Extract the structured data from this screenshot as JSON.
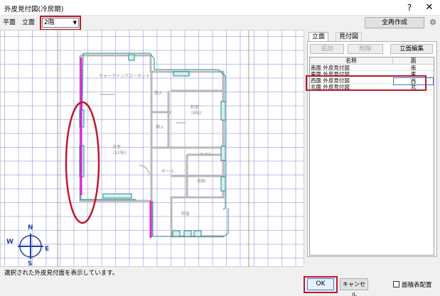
{
  "window": {
    "title": "外皮見付図(冷房期)",
    "help_label": "?",
    "close_label": "✕"
  },
  "toolbar": {
    "plan_label": "平面",
    "elevation_label": "立面",
    "floor_value": "2階",
    "all_create_label": "全再作成"
  },
  "plan": {
    "room_labels": [
      "ウォークインクローゼット",
      "洋室",
      "(12帖)",
      "和室",
      "(6帖)",
      "ホール",
      "トイレ",
      "押入",
      "収納",
      "吹抜",
      "物入"
    ],
    "compass": {
      "n": "N",
      "e": "E",
      "s": "S",
      "w": "W"
    }
  },
  "status": {
    "text": "選択された外皮見付面を表示しています。"
  },
  "panel": {
    "tabs": [
      "立面",
      "見付図"
    ],
    "buttons": {
      "add": "追加",
      "delete": "削除",
      "edit": "立面編集"
    },
    "columns": {
      "name": "名称",
      "dir": "面"
    },
    "rows": [
      {
        "name": "南面 外皮見付図",
        "dir": "南"
      },
      {
        "name": "東面 外皮見付図",
        "dir": "東"
      },
      {
        "name": "西面 外皮見付図",
        "dir": "西"
      },
      {
        "name": "北面 外皮見付図",
        "dir": "北"
      }
    ],
    "selected_row": 2
  },
  "footer": {
    "ok_label": "OK",
    "cancel_label": "キャンセル",
    "area_table_label": "面積表配置"
  },
  "colors": {
    "highlight": "#c0192b",
    "selected_wall": "#e01fd6",
    "window_outline": "#1f8a8a",
    "grid": "#8c8cdc"
  }
}
